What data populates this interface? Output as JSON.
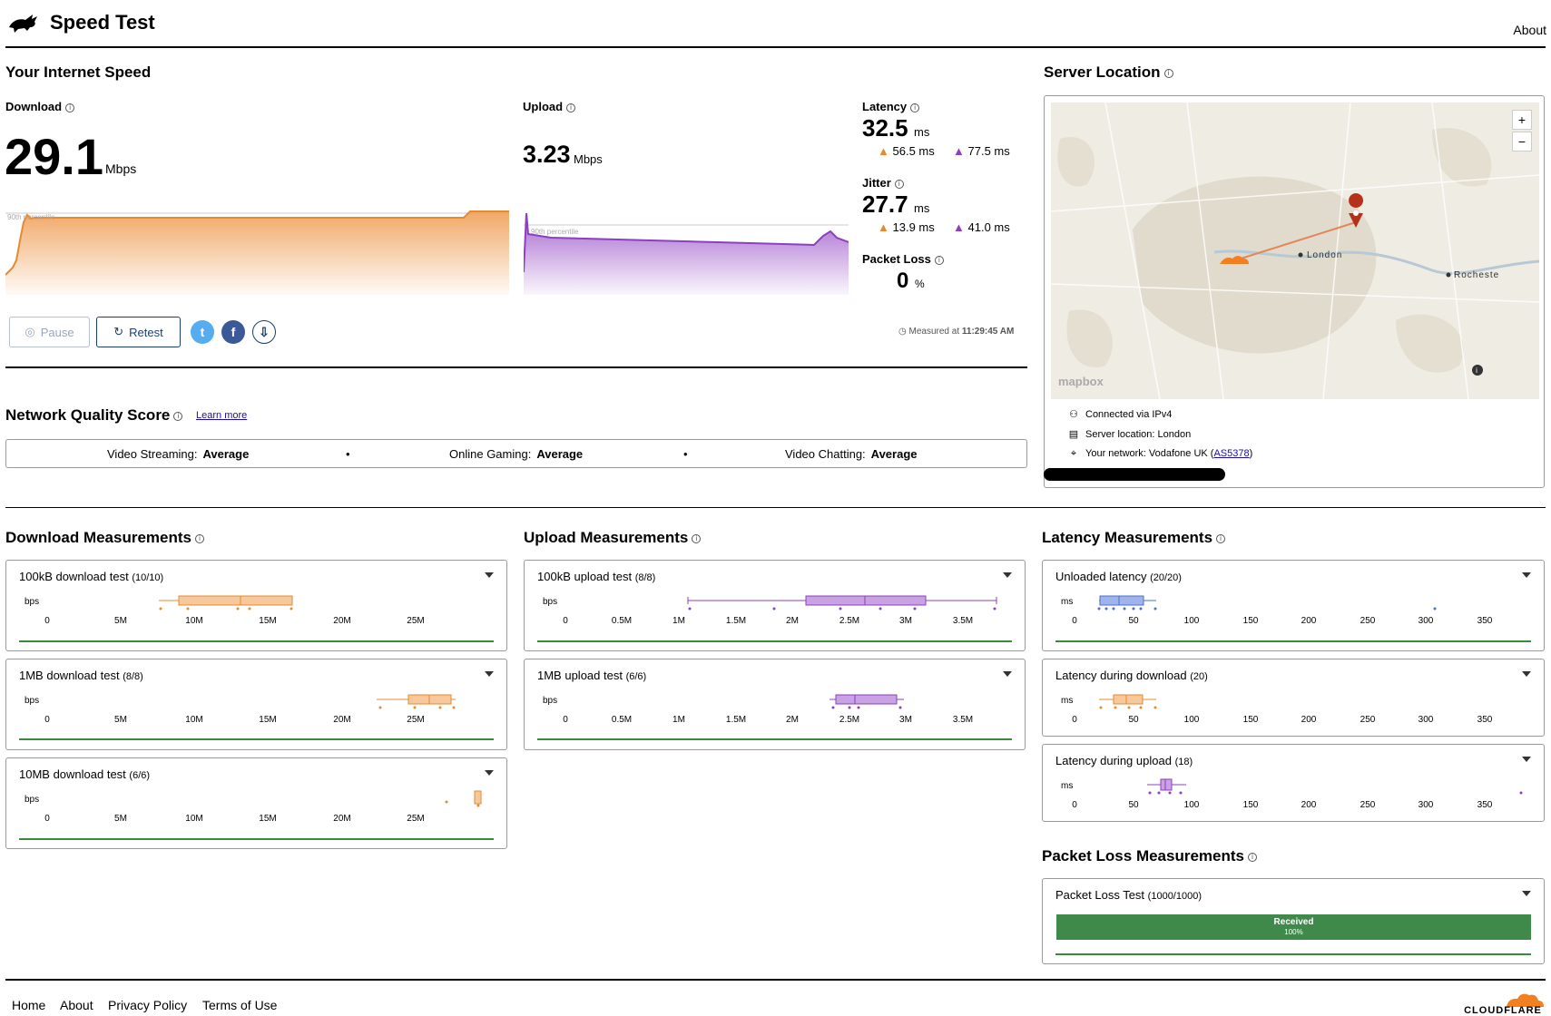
{
  "header": {
    "title": "Speed Test",
    "about": "About"
  },
  "speed": {
    "title": "Your Internet Speed",
    "download": {
      "label": "Download",
      "value": "29.1",
      "unit": "Mbps"
    },
    "upload": {
      "label": "Upload",
      "value": "3.23",
      "unit": "Mbps"
    },
    "latency": {
      "label": "Latency",
      "value": "32.5",
      "unit": "ms",
      "down": "56.5 ms",
      "up": "77.5 ms"
    },
    "jitter": {
      "label": "Jitter",
      "value": "27.7",
      "unit": "ms",
      "down": "13.9 ms",
      "up": "41.0 ms"
    },
    "packet_loss": {
      "label": "Packet Loss",
      "value": "0",
      "unit": "%"
    },
    "download_chart_label": "90th percentile",
    "upload_chart_label": "90th percentile",
    "measured_prefix": "Measured at ",
    "measured_time": "11:29:45 AM",
    "pause_label": "Pause",
    "retest_label": "Retest"
  },
  "network_quality": {
    "title": "Network Quality Score",
    "learn_more": "Learn more",
    "items": [
      {
        "label": "Video Streaming:",
        "value": "Average"
      },
      {
        "label": "Online Gaming:",
        "value": "Average"
      },
      {
        "label": "Video Chatting:",
        "value": "Average"
      }
    ]
  },
  "server": {
    "title": "Server Location",
    "map_city": "London",
    "map_city2": "Rocheste",
    "map_attrib": "mapbox",
    "connected": "Connected via IPv4",
    "location": "Server location: London",
    "network_prefix": "Your network: Vodafone UK (",
    "asn": "AS5378",
    "network_suffix": ")"
  },
  "download_measurements": {
    "title": "Download Measurements",
    "unit": "bps",
    "ticks": [
      "0",
      "5M",
      "10M",
      "15M",
      "20M",
      "25M"
    ],
    "tests": [
      {
        "title": "100kB download test",
        "count": "(10/10)"
      },
      {
        "title": "1MB download test",
        "count": "(8/8)"
      },
      {
        "title": "10MB download test",
        "count": "(6/6)"
      }
    ]
  },
  "upload_measurements": {
    "title": "Upload Measurements",
    "unit": "bps",
    "ticks": [
      "0",
      "0.5M",
      "1M",
      "1.5M",
      "2M",
      "2.5M",
      "3M",
      "3.5M"
    ],
    "tests": [
      {
        "title": "100kB upload test",
        "count": "(8/8)"
      },
      {
        "title": "1MB upload test",
        "count": "(6/6)"
      }
    ]
  },
  "latency_measurements": {
    "title": "Latency Measurements",
    "unit": "ms",
    "ticks": [
      "0",
      "50",
      "100",
      "150",
      "200",
      "250",
      "300",
      "350"
    ],
    "ticks_upload": [
      "0",
      "50",
      "100",
      "150",
      "200",
      "250",
      "300",
      "350"
    ],
    "tests": [
      {
        "title": "Unloaded latency",
        "count": "(20/20)"
      },
      {
        "title": "Latency during download",
        "count": "(20)"
      },
      {
        "title": "Latency during upload",
        "count": "(18)"
      }
    ]
  },
  "packet_loss": {
    "title": "Packet Loss Measurements",
    "test": {
      "title": "Packet Loss Test",
      "count": "(1000/1000)"
    },
    "bar_label": "Received",
    "bar_pct": "100%",
    "received_fraction": 1.0
  },
  "footer": {
    "home": "Home",
    "about": "About",
    "privacy": "Privacy Policy",
    "terms": "Terms of Use",
    "brand": "CLOUDFLARE"
  },
  "colors": {
    "download": "#f0a35e",
    "upload": "#a15ccc",
    "latency": "#4a6fd0",
    "green": "#3a8a3a",
    "nav": "#1a3e74"
  }
}
